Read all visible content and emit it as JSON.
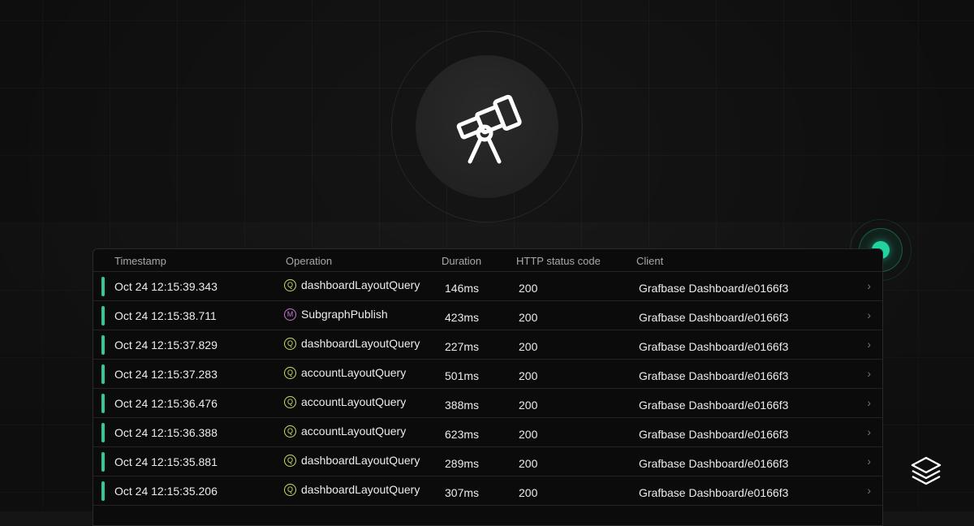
{
  "table": {
    "headers": {
      "timestamp": "Timestamp",
      "operation": "Operation",
      "duration": "Duration",
      "status": "HTTP status code",
      "client": "Client"
    },
    "rows": [
      {
        "timestamp": "Oct 24 12:15:39.343",
        "type": "Q",
        "operation": "dashboardLayoutQuery",
        "duration": "146ms",
        "status": "200",
        "client": "Grafbase Dashboard/e0166f3"
      },
      {
        "timestamp": "Oct 24 12:15:38.711",
        "type": "M",
        "operation": "SubgraphPublish",
        "duration": "423ms",
        "status": "200",
        "client": "Grafbase Dashboard/e0166f3"
      },
      {
        "timestamp": "Oct 24 12:15:37.829",
        "type": "Q",
        "operation": "dashboardLayoutQuery",
        "duration": "227ms",
        "status": "200",
        "client": "Grafbase Dashboard/e0166f3"
      },
      {
        "timestamp": "Oct 24 12:15:37.283",
        "type": "Q",
        "operation": "accountLayoutQuery",
        "duration": "501ms",
        "status": "200",
        "client": "Grafbase Dashboard/e0166f3"
      },
      {
        "timestamp": "Oct 24 12:15:36.476",
        "type": "Q",
        "operation": "accountLayoutQuery",
        "duration": "388ms",
        "status": "200",
        "client": "Grafbase Dashboard/e0166f3"
      },
      {
        "timestamp": "Oct 24 12:15:36.388",
        "type": "Q",
        "operation": "accountLayoutQuery",
        "duration": "623ms",
        "status": "200",
        "client": "Grafbase Dashboard/e0166f3"
      },
      {
        "timestamp": "Oct 24 12:15:35.881",
        "type": "Q",
        "operation": "dashboardLayoutQuery",
        "duration": "289ms",
        "status": "200",
        "client": "Grafbase Dashboard/e0166f3"
      },
      {
        "timestamp": "Oct 24 12:15:35.206",
        "type": "Q",
        "operation": "dashboardLayoutQuery",
        "duration": "307ms",
        "status": "200",
        "client": "Grafbase Dashboard/e0166f3"
      }
    ]
  },
  "icons": {
    "hero": "telescope-icon",
    "row_chevron": "chevron-right-icon",
    "status": "live-status-dot",
    "logo": "grafbase-logo-icon"
  },
  "colors": {
    "status_bar": "#35c79a",
    "query_badge": "#c8e06a",
    "mutation_badge": "#c47ad6",
    "live_dot": "#22d3a0"
  }
}
